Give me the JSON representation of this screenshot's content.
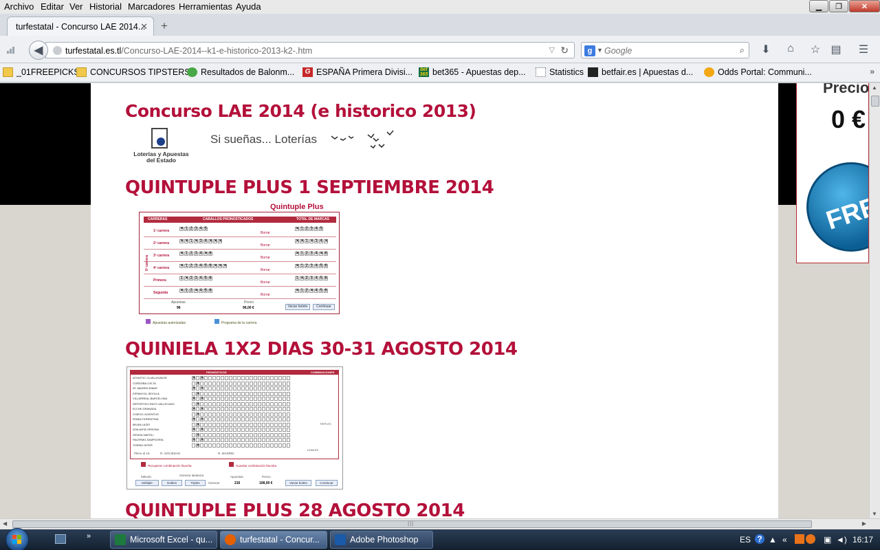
{
  "menubar": {
    "items": [
      "Archivo",
      "Editar",
      "Ver",
      "Historial",
      "Marcadores",
      "Herramientas",
      "Ayuda"
    ]
  },
  "tabs": {
    "active_title": "turfestatal - Concurso LAE 2014...",
    "new_tab": "+",
    "close": "✕"
  },
  "navbar": {
    "url_domain": "turfestatal.es.tl",
    "url_path": "/Concurso-LAE-2014--k1-e-historico-2013-k2-.htm",
    "search_placeholder": "Google",
    "search_engine_icon": "google-icon"
  },
  "bookmarks": [
    {
      "label": "_01FREEPICKS",
      "icon": "folder"
    },
    {
      "label": "CONCURSOS TIPSTERS",
      "icon": "folder"
    },
    {
      "label": "Resultados de Balonm...",
      "icon": "green"
    },
    {
      "label": "ESPAÑA Primera Divisi...",
      "icon": "red"
    },
    {
      "label": "bet365 - Apuestas dep...",
      "icon": "bet"
    },
    {
      "label": "Statistics",
      "icon": "dotted"
    },
    {
      "label": "betfair.es | Apuestas d...",
      "icon": "bf"
    },
    {
      "label": "Odds Portal: Communi...",
      "icon": "odds"
    }
  ],
  "page": {
    "title": "Concurso LAE 2014 (e historico 2013)",
    "logo_text": "Loterías y Apuestas del Estado",
    "slogan": "Si sueñas... Loterías",
    "posts": [
      {
        "heading": "QUINTUPLE PLUS 1 SEPTIEMBRE 2014"
      },
      {
        "heading": "QUINIELA 1X2 DIAS 30-31 AGOSTO 2014"
      },
      {
        "heading": "QUINTUPLE PLUS 28 AGOSTO 2014"
      }
    ]
  },
  "quintuple_ticket": {
    "brand": "Quintuple Plus",
    "header_carreras": "CARRERAS",
    "header_caballos": "CABALLOS PRONOSTICADOS",
    "header_total": "TOTAL DE MARCAS",
    "rows": [
      {
        "label": "1ª carrera",
        "marks": "X12345",
        "action": "Borrar"
      },
      {
        "label": "2ª carrera",
        "marks": "XX1X34XXX",
        "action": "Borrar"
      },
      {
        "label": "3ª carrera",
        "marks": "X1234X6",
        "action": "Borrar"
      },
      {
        "label": "4ª carrera",
        "marks": "X123456XXX",
        "action": "Borrar"
      },
      {
        "label": "Primera",
        "marks": "1X23456",
        "action": "Borrar"
      },
      {
        "label": "Segunda",
        "marks": "X12X456",
        "action": "Borrar"
      }
    ],
    "side_label": "5ª carrera",
    "apuestas_label": "Apuestas",
    "apuestas_value": "96",
    "precio_label": "Precio",
    "precio_value": "96,00 €",
    "btn_vaciar": "Vaciar boleto",
    "btn_continuar": "Continuar",
    "footer_left": "Apuestas autorizadas",
    "footer_right": "Programa de la carrera"
  },
  "quiniela_ticket": {
    "header_pronosticos": "PRONÓSTICOS",
    "header_combinaciones": "COMBINACIONES",
    "matches": [
      "ATHLETIC CLUB-LEVANTE",
      "CORDOBA-CELTA",
      "AT. MADRID-EIBAR",
      "ESPANYOL-SEVILLA",
      "VILLARREAL-BARCELONA",
      "DEPORTIVO-RAYO VALLECANO",
      "ELCHE-GRANADA",
      "CHIEVO-JUVENTUS",
      "ROMA-FIORENTINA",
      "MILAN-LAZIO",
      "ATALANTA-VERONA",
      "GENOA-NAPOLI",
      "PALERMO-SAMPDORIA",
      "TORINO-INTER"
    ],
    "pleno_label": "Pleno al 15",
    "pleno_home": "R. SOCIEDAD",
    "pleno_away": "R. MADRID",
    "triples_label": "TRIPLES",
    "dobles_label": "DOBLES",
    "recuperar": "Recuperar combinación favorita",
    "guardar": "Guardar combinación favorita",
    "metodo_label": "Método",
    "metodo_value": "Múltiple",
    "generar_label": "Generar aleatoria",
    "dobles_select": "Dobles",
    "triples_select": "Triples",
    "generar_btn": "Generar",
    "apuestas_label": "Apuestas",
    "apuestas_value": "216",
    "precio_label": "Precio",
    "precio_value": "108,00 €",
    "btn_vaciar": "Vaciar boleto",
    "btn_continuar": "Continuar"
  },
  "sidebar_ad": {
    "price_label": "Precio",
    "price_value": "0 €",
    "badge": "FREE"
  },
  "taskbar": {
    "tasks": [
      {
        "label": "Microsoft Excel - qu...",
        "icon": "excel-icon",
        "color": "#1d7a3e"
      },
      {
        "label": "turfestatal - Concur...",
        "icon": "firefox-icon",
        "color": "#e66000"
      },
      {
        "label": "Adobe Photoshop",
        "icon": "photoshop-icon",
        "color": "#1a5aa8"
      }
    ],
    "lang": "ES",
    "clock": "16:17"
  },
  "colors": {
    "heading": "#b3103a",
    "ticket_red": "#b22a3e"
  }
}
